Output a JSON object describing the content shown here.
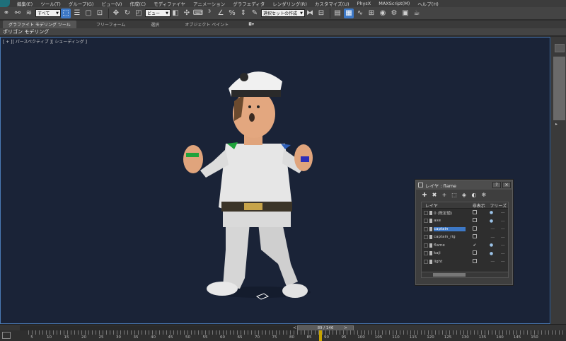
{
  "menu": [
    "編集(E)",
    "ツール(T)",
    "グループ(G)",
    "ビュー(V)",
    "作成(C)",
    "モディファイヤ",
    "アニメーション",
    "グラフエディタ",
    "レンダリング(R)",
    "カスタマイズ(U)",
    "PhysX",
    "MAXScript(M)",
    "ヘルプ(H)"
  ],
  "toolbar": {
    "selection_filter": "すべて",
    "ref_coord": "ビュー",
    "named_selection": "選択セットの作成"
  },
  "ribbon": {
    "tabs": [
      "グラファイト モデリング ツール",
      "フリーフォーム",
      "選択",
      "オブジェクト ペイント"
    ],
    "sub_label": "ポリゴン モデリング"
  },
  "viewport": {
    "label": "[ + ][ パースペクティブ ][ シェーディング ]"
  },
  "time_slider": {
    "frame_readout": "89 / 146",
    "prev": "<",
    "next": ">"
  },
  "ruler": {
    "ticks": [
      "5",
      "10",
      "15",
      "20",
      "25",
      "30",
      "35",
      "40",
      "45",
      "50",
      "55",
      "60",
      "65",
      "70",
      "75",
      "80",
      "85",
      "90",
      "95",
      "100",
      "105",
      "110",
      "115",
      "120",
      "125",
      "130",
      "135",
      "140",
      "145",
      "150"
    ]
  },
  "layer_dialog": {
    "title": "レイヤ : flame",
    "help_btn": "?",
    "close_btn": "×",
    "col_layer": "レイヤ",
    "col_hide": "非表示",
    "col_freeze": "フリーズ",
    "layers": [
      {
        "name": "0 (既定値)",
        "selected": false
      },
      {
        "name": "axe",
        "selected": false
      },
      {
        "name": "captain",
        "selected": true
      },
      {
        "name": "captain_rig",
        "selected": false
      },
      {
        "name": "flame",
        "selected": false
      },
      {
        "name": "kaji",
        "selected": false
      },
      {
        "name": "light",
        "selected": false
      }
    ]
  },
  "colors": {
    "viewport_bg": "#1a2337",
    "active_blue": "#3d78c6",
    "ruler_marker": "#c8a400"
  }
}
